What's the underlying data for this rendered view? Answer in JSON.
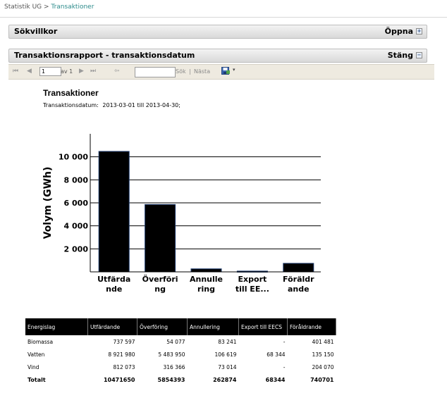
{
  "breadcrumb": {
    "root": "Statistik UG",
    "sep": " > ",
    "current": "Transaktioner"
  },
  "panels": {
    "search": {
      "title": "Sökvillkor",
      "action": "Öppna",
      "btn": "+"
    },
    "report": {
      "title": "Transaktionsrapport - transaktionsdatum",
      "action": "Stäng",
      "btn": "−"
    }
  },
  "toolbar": {
    "first": "⏮",
    "prev": "◀",
    "page": "1",
    "of_label": "av 1",
    "next": "▶",
    "last": "⏭",
    "back": "⇦",
    "find_label": "Sök",
    "separator": "|",
    "next_label": "Nästa",
    "export_icon": "disk-icon",
    "export_arrow": "▾"
  },
  "report": {
    "title": "Transaktioner",
    "date_label": "Transaktionsdatum:",
    "date_value": "2013-03-01 till 2013-04-30;"
  },
  "chart_data": {
    "type": "bar",
    "title": "",
    "xlabel": "",
    "ylabel": "Volym (GWh)",
    "categories": [
      [
        "Utfärda",
        "nde"
      ],
      [
        "Överföri",
        "ng"
      ],
      [
        "Annulle",
        "ring"
      ],
      [
        "Export",
        "till EE..."
      ],
      [
        "Föräldr",
        "ande"
      ]
    ],
    "values": [
      10471650,
      5854393,
      262874,
      68344,
      740701
    ],
    "yticks": [
      "2 000",
      "4 000",
      "6 000",
      "8 000",
      "10 000"
    ],
    "ylim": [
      0,
      12000
    ],
    "grid": true,
    "bar_color": "#000000",
    "edge_color": "#1d3a6b"
  },
  "table": {
    "headers": [
      "Energislag",
      "Utfärdande",
      "Överföring",
      "Annullering",
      "Export till EECS",
      "Föråldrande"
    ],
    "rows": [
      [
        "Biomassa",
        "737 597",
        "54 077",
        "83 241",
        "-",
        "401 481"
      ],
      [
        "Vatten",
        "8 921 980",
        "5 483 950",
        "106 619",
        "68 344",
        "135 150"
      ],
      [
        "Vind",
        "812 073",
        "316 366",
        "73 014",
        "-",
        "204 070"
      ]
    ],
    "total": [
      "Totalt",
      "10471650",
      "5854393",
      "262874",
      "68344",
      "740701"
    ]
  }
}
